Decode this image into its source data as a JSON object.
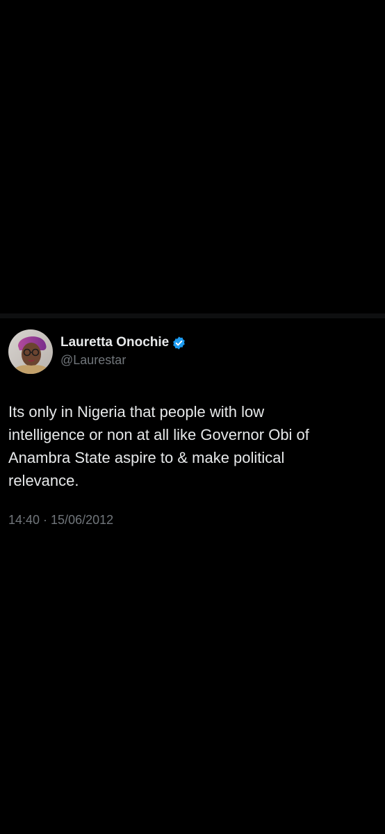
{
  "tweet": {
    "display_name": "Lauretta Onochie",
    "handle": "@Laurestar",
    "text": "Its only in Nigeria that people with low\nintelligence or non at all like Governor Obi of\nAnambra State aspire to & make political\nrelevance.",
    "timestamp": "14:40 · 15/06/2012",
    "verified": true,
    "avatar_icon": "profile-photo",
    "verified_icon": "verified-badge-icon"
  },
  "colors": {
    "background": "#000000",
    "text_primary": "#e7e9ea",
    "text_secondary": "#71767b",
    "verified_badge": "#1d9bf0"
  }
}
